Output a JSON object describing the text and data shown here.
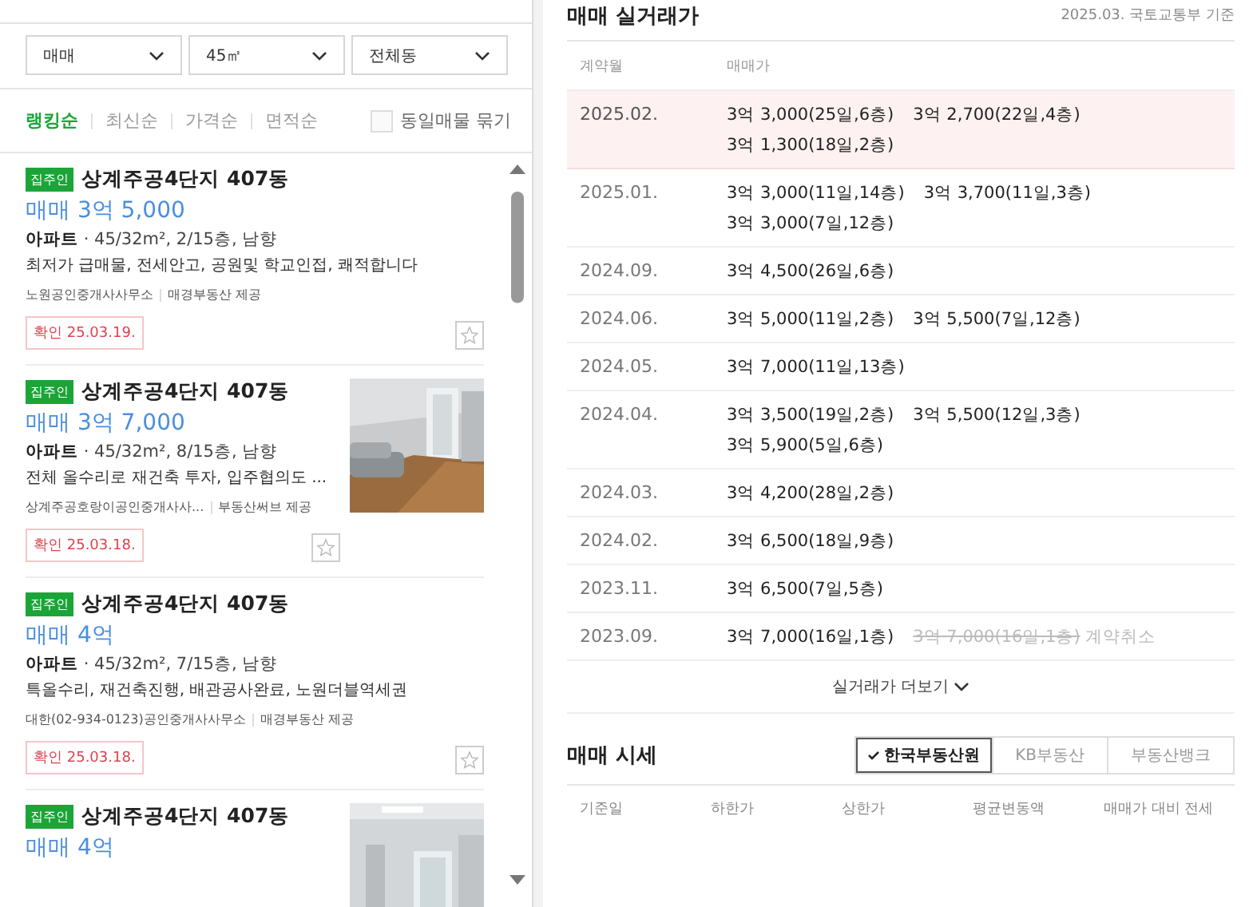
{
  "filters": [
    {
      "value": "매매"
    },
    {
      "value": "45㎡"
    },
    {
      "value": "전체동"
    }
  ],
  "sort_tabs": [
    {
      "label": "랭킹순",
      "selected": true
    },
    {
      "label": "최신순",
      "selected": false
    },
    {
      "label": "가격순",
      "selected": false
    },
    {
      "label": "면적순",
      "selected": false
    }
  ],
  "group_same": {
    "label": "동일매물 묶기",
    "checked": false
  },
  "listings": [
    {
      "badge": "집주인",
      "title": "상계주공4단지 407동",
      "price": "매매 3억 5,000",
      "type": "아파트",
      "details": "· 45/32m², 2/15층, 남향",
      "description": "최저가 급매물, 전세안고, 공원및 학교인접, 쾌적합니다",
      "agent": "노원공인중개사사무소",
      "provider": "매경부동산 제공",
      "confirmed": "확인 25.03.19.",
      "photo": false,
      "favorite": false
    },
    {
      "badge": "집주인",
      "title": "상계주공4단지 407동",
      "price": "매매 3억 7,000",
      "type": "아파트",
      "details": "· 45/32m², 8/15층, 남향",
      "description": "전체 올수리로 재건축 투자, 입주협의도 ...",
      "agent": "상계주공호랑이공인중개사사...",
      "provider": "부동산써브 제공",
      "confirmed": "확인 25.03.18.",
      "photo": true,
      "favorite": false
    },
    {
      "badge": "집주인",
      "title": "상계주공4단지 407동",
      "price": "매매 4억",
      "type": "아파트",
      "details": "· 45/32m², 7/15층, 남향",
      "description": "특올수리, 재건축진행, 배관공사완료, 노원더블역세권",
      "agent": "대한(02-934-0123)공인중개사사무소",
      "provider": "매경부동산 제공",
      "confirmed": "확인 25.03.18.",
      "photo": false,
      "favorite": false
    },
    {
      "badge": "집주인",
      "title": "상계주공4단지 407동",
      "price": "매매 4억",
      "photo": true
    }
  ],
  "transactions": {
    "title": "매매 실거래가",
    "source": "2025.03. 국토교통부 기준",
    "columns": [
      "계약월",
      "매매가"
    ],
    "rows": [
      {
        "month": "2025.02.",
        "selected": true,
        "trades": [
          {
            "price": "3억 3,000(25일,6층)",
            "cancelled": false
          },
          {
            "price": "3억 2,700(22일,4층)",
            "cancelled": false
          },
          {
            "price": "3억 1,300(18일,2층)",
            "cancelled": false
          }
        ]
      },
      {
        "month": "2025.01.",
        "selected": false,
        "trades": [
          {
            "price": "3억 3,000(11일,14층)",
            "cancelled": false
          },
          {
            "price": "3억 3,700(11일,3층)",
            "cancelled": false
          },
          {
            "price": "3억 3,000(7일,12층)",
            "cancelled": false
          }
        ]
      },
      {
        "month": "2024.09.",
        "selected": false,
        "trades": [
          {
            "price": "3억 4,500(26일,6층)",
            "cancelled": false
          }
        ]
      },
      {
        "month": "2024.06.",
        "selected": false,
        "trades": [
          {
            "price": "3억 5,000(11일,2층)",
            "cancelled": false
          },
          {
            "price": "3억 5,500(7일,12층)",
            "cancelled": false
          }
        ]
      },
      {
        "month": "2024.05.",
        "selected": false,
        "trades": [
          {
            "price": "3억 7,000(11일,13층)",
            "cancelled": false
          }
        ]
      },
      {
        "month": "2024.04.",
        "selected": false,
        "trades": [
          {
            "price": "3억 3,500(19일,2층)",
            "cancelled": false
          },
          {
            "price": "3억 5,500(12일,3층)",
            "cancelled": false
          },
          {
            "price": "3억 5,900(5일,6층)",
            "cancelled": false
          }
        ]
      },
      {
        "month": "2024.03.",
        "selected": false,
        "trades": [
          {
            "price": "3억 4,200(28일,2층)",
            "cancelled": false
          }
        ]
      },
      {
        "month": "2024.02.",
        "selected": false,
        "trades": [
          {
            "price": "3억 6,500(18일,9층)",
            "cancelled": false
          }
        ]
      },
      {
        "month": "2023.11.",
        "selected": false,
        "trades": [
          {
            "price": "3억 6,500(7일,5층)",
            "cancelled": false
          }
        ]
      },
      {
        "month": "2023.09.",
        "selected": false,
        "trades": [
          {
            "price": "3억 7,000(16일,1층)",
            "cancelled": false
          },
          {
            "price": "3억 7,000(16일,1층)",
            "cancelled": true,
            "note": "계약취소"
          }
        ]
      }
    ],
    "more": "실거래가 더보기"
  },
  "market": {
    "title": "매매 시세",
    "sources": [
      {
        "label": "한국부동산원",
        "selected": true
      },
      {
        "label": "KB부동산",
        "selected": false
      },
      {
        "label": "부동산뱅크",
        "selected": false
      }
    ],
    "columns": [
      "기준일",
      "하한가",
      "상한가",
      "평균변동액",
      "매매가 대비 전세"
    ]
  }
}
